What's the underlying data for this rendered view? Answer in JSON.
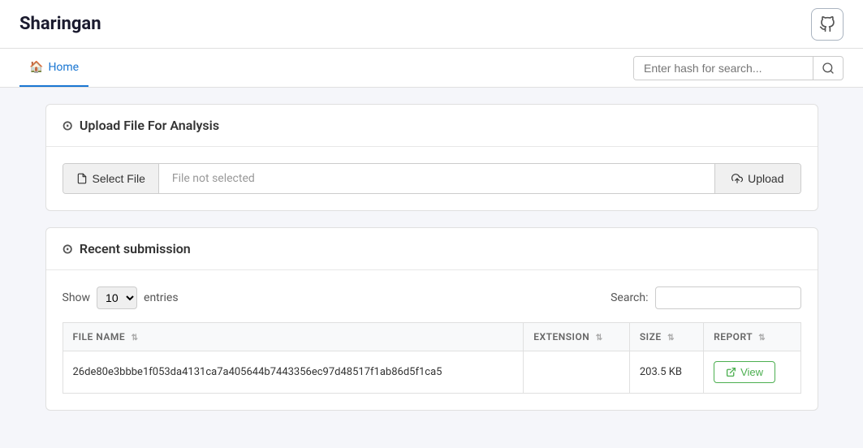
{
  "app": {
    "title": "Sharingan",
    "github_icon": "⎔"
  },
  "nav": {
    "home_label": "Home",
    "search_placeholder": "Enter hash for search..."
  },
  "upload_card": {
    "title": "Upload File For Analysis",
    "select_file_label": "Select File",
    "file_placeholder": "File not selected",
    "upload_label": "Upload"
  },
  "recent_card": {
    "title": "Recent submission",
    "show_label": "Show",
    "entries_label": "entries",
    "entries_value": "10",
    "search_label": "Search:",
    "table": {
      "columns": [
        {
          "key": "file_name",
          "label": "FILE NAME"
        },
        {
          "key": "extension",
          "label": "EXTENSION"
        },
        {
          "key": "size",
          "label": "SIZE"
        },
        {
          "key": "report",
          "label": "REPORT"
        }
      ],
      "rows": [
        {
          "file_name": "26de80e3bbbe1f053da4131ca7a405644b7443356ec97d48517f1ab86d5f1ca5",
          "extension": "",
          "size": "203.5 KB",
          "report_label": "View"
        }
      ]
    }
  }
}
